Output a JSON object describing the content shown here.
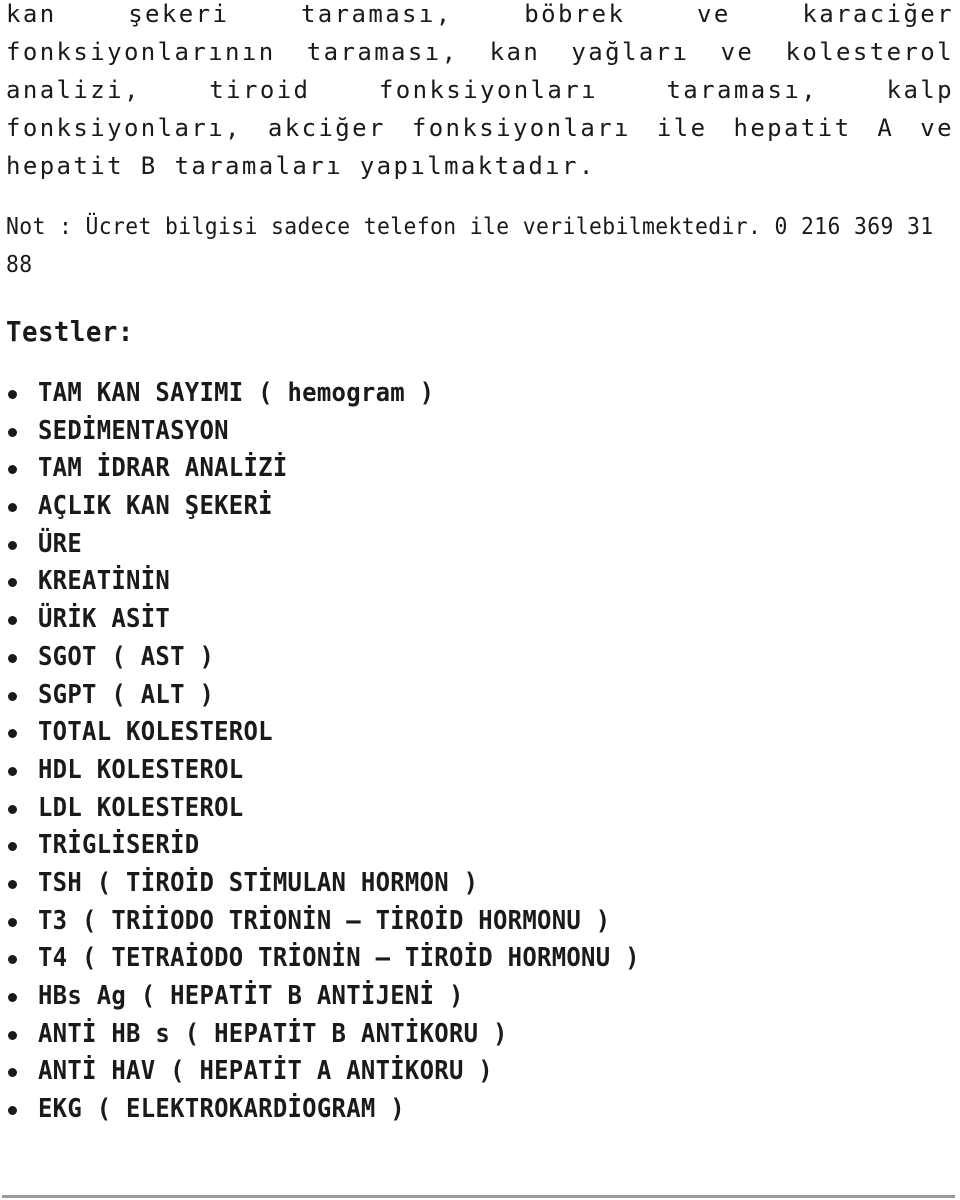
{
  "intro_paragraph": "kan şekeri taraması, böbrek ve karaciğer fonksiyonlarının taraması, kan yağları ve kolesterol analizi, tiroid fonksiyonları taraması, kalp fonksiyonları, akciğer fonksiyonları ile hepatit A ve hepatit B taramaları yapılmaktadır.",
  "note": {
    "text": "Not : Ücret bilgisi sadece telefon ile verilebilmektedir. 0 216 369 31 88",
    "phone": "0 216 369 31 88"
  },
  "tests_section": {
    "heading": "Testler:",
    "items": [
      "TAM KAN SAYIMI ( hemogram )",
      "SEDİMENTASYON",
      "TAM İDRAR ANALİZİ",
      "AÇLIK KAN ŞEKERİ",
      "ÜRE",
      "KREATİNİN",
      "ÜRİK ASİT",
      "SGOT ( AST )",
      "SGPT ( ALT )",
      "TOTAL KOLESTEROL",
      "HDL KOLESTEROL",
      "LDL KOLESTEROL",
      "TRİGLİSERİD",
      "TSH ( TİROİD STİMULAN HORMON )",
      "T3 ( TRİİODO TRİONİN – TİROİD HORMONU )",
      "T4 ( TETRAİODO TRİONİN – TİROİD HORMONU )",
      "HBs Ag ( HEPATİT B ANTİJENİ )",
      "ANTİ HB s ( HEPATİT B ANTİKORU )",
      "ANTİ HAV ( HEPATİT A ANTİKORU )",
      "EKG ( ELEKTROKARDİOGRAM )"
    ]
  }
}
